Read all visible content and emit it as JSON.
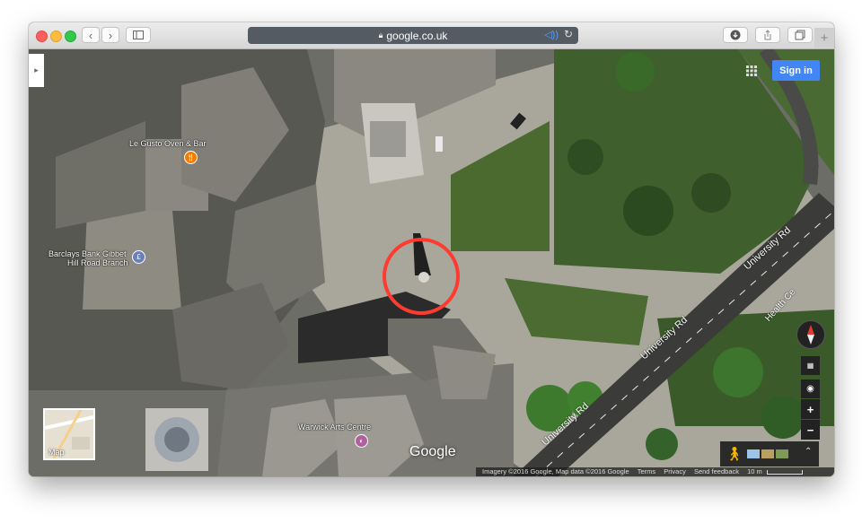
{
  "browser": {
    "url": "google.co.uk",
    "back_icon": "chevron-left-icon",
    "forward_icon": "chevron-right-icon"
  },
  "map": {
    "labels": {
      "restaurant": "Le Gusto Oven & Bar",
      "bank_line1": "Barclays Bank Gibbet",
      "bank_line2": "Hill Road Branch",
      "arts_centre": "Warwick Arts Centre"
    },
    "roads": [
      "University Rd",
      "University Rd",
      "University Rd",
      "Health Ce"
    ],
    "logo": "Google",
    "sign_in": "Sign in",
    "map_thumbnail_label": "Map",
    "zoom_in": "+",
    "zoom_out": "−",
    "footer": {
      "imagery": "Imagery ©2016 Google, Map data ©2016 Google",
      "terms": "Terms",
      "privacy": "Privacy",
      "feedback": "Send feedback",
      "scale": "10 m"
    }
  }
}
